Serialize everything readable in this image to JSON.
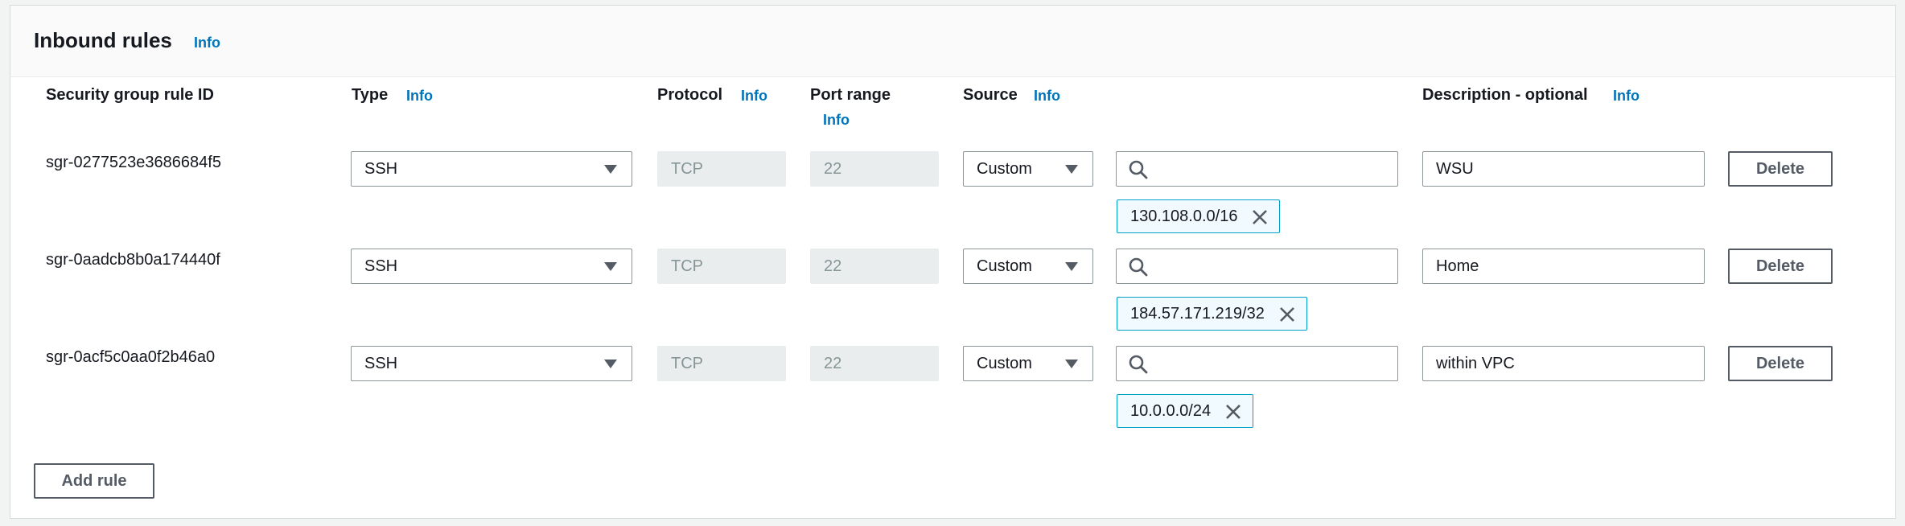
{
  "section": {
    "title": "Inbound rules",
    "info": "Info"
  },
  "columns": {
    "rule_id": "Security group rule ID",
    "type": "Type",
    "type_info": "Info",
    "protocol": "Protocol",
    "protocol_info": "Info",
    "port_range": "Port range",
    "port_info": "Info",
    "source": "Source",
    "source_info": "Info",
    "description": "Description - optional",
    "description_info": "Info"
  },
  "rules": [
    {
      "id": "sgr-0277523e3686684f5",
      "type": "SSH",
      "protocol": "TCP",
      "port": "22",
      "source_type": "Custom",
      "search_value": "",
      "cidr": "130.108.0.0/16",
      "description": "WSU",
      "delete_label": "Delete"
    },
    {
      "id": "sgr-0aadcb8b0a174440f",
      "type": "SSH",
      "protocol": "TCP",
      "port": "22",
      "source_type": "Custom",
      "search_value": "",
      "cidr": "184.57.171.219/32",
      "description": "Home",
      "delete_label": "Delete"
    },
    {
      "id": "sgr-0acf5c0aa0f2b46a0",
      "type": "SSH",
      "protocol": "TCP",
      "port": "22",
      "source_type": "Custom",
      "search_value": "",
      "cidr": "10.0.0.0/24",
      "description": "within VPC",
      "delete_label": "Delete"
    }
  ],
  "add_rule_label": "Add rule",
  "colors": {
    "link": "#0073bb",
    "token_border": "#00a1c9",
    "token_bg": "#f1faff",
    "disabled_bg": "#eaeded"
  },
  "icons": {
    "search": "search-icon",
    "remove": "close-icon",
    "dropdown": "caret-down-icon"
  }
}
